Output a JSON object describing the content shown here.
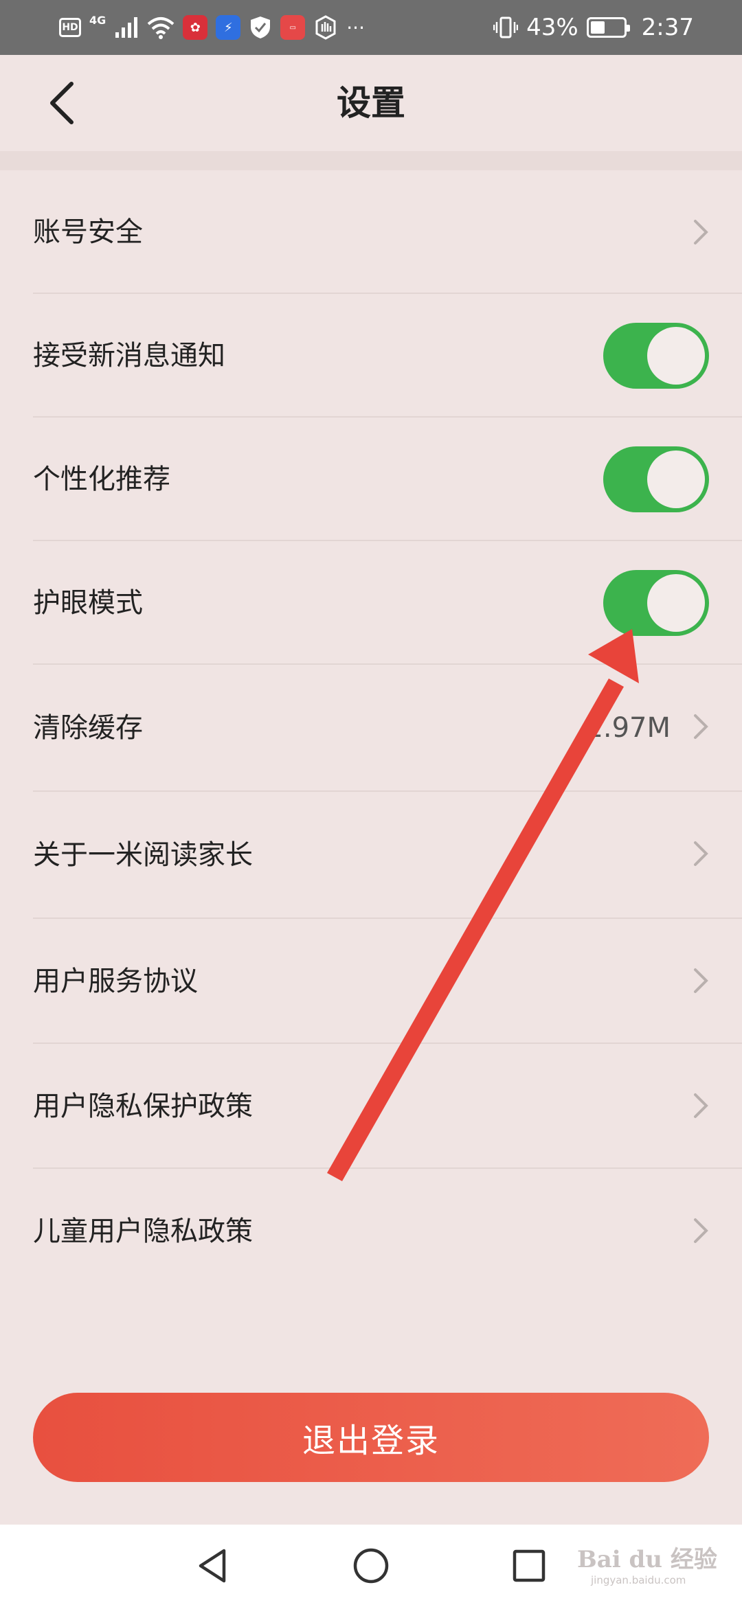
{
  "status_bar": {
    "left_items": [
      "HD",
      "4G"
    ],
    "battery_percent": "43%",
    "battery_level": 0.43,
    "time": "2:37"
  },
  "header": {
    "title": "设置"
  },
  "settings": [
    {
      "label": "账号安全",
      "type": "link"
    },
    {
      "label": "接受新消息通知",
      "type": "toggle",
      "on": true
    },
    {
      "label": "个性化推荐",
      "type": "toggle",
      "on": true
    },
    {
      "label": "护眼模式",
      "type": "toggle",
      "on": true
    },
    {
      "label": "清除缓存",
      "type": "link",
      "value": "1.97M"
    },
    {
      "label": "关于一米阅读家长",
      "type": "link"
    },
    {
      "label": "用户服务协议",
      "type": "link"
    },
    {
      "label": "用户隐私保护政策",
      "type": "link"
    },
    {
      "label": "儿童用户隐私政策",
      "type": "link"
    }
  ],
  "logout_label": "退出登录",
  "colors": {
    "toggle_on": "#3cb34d",
    "logout_start": "#e8503f",
    "logout_end": "#ef6c57",
    "annotation_arrow": "#e8443a"
  },
  "icons": {
    "back": "chevron-left-icon",
    "row_link": "chevron-right-icon",
    "nav": [
      "back-triangle-icon",
      "home-circle-icon",
      "recents-square-icon"
    ]
  },
  "watermark": {
    "text": "Bai du 经验",
    "subtext": "jingyan.baidu.com"
  }
}
